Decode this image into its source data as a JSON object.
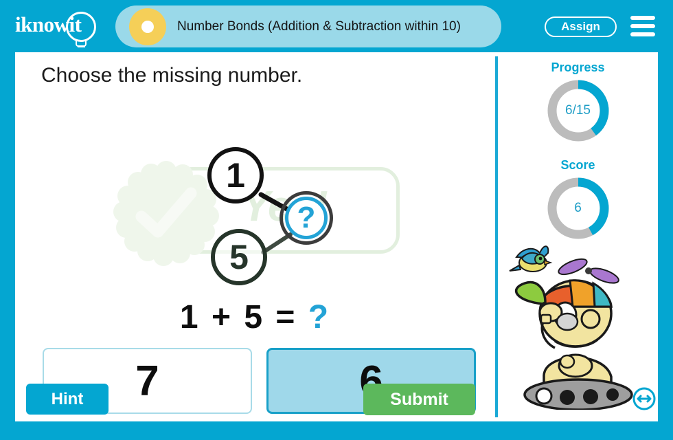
{
  "header": {
    "logo_text": "iknowit",
    "logo_icon": "lightbulb-icon",
    "title": "Number Bonds (Addition & Subtraction within 10)",
    "assign_label": "Assign",
    "menu_icon": "hamburger-menu-icon",
    "bar_color": "#04a6d1",
    "banner_color": "#9ad9e9",
    "dot_color": "#f5cf58"
  },
  "main": {
    "prompt": "Choose the missing number.",
    "number_bond": {
      "part_a": "1",
      "part_b": "5",
      "whole": "?",
      "whole_color": "#23a3d6"
    },
    "equation": {
      "left": "1",
      "operator": "+",
      "right": "5",
      "equals": "=",
      "result": "?"
    },
    "feedback": {
      "text": "Yes!",
      "icon": "check-seal-icon",
      "color": "#a8cf9c"
    },
    "choices": [
      {
        "label": "7",
        "selected": false
      },
      {
        "label": "6",
        "selected": true
      }
    ],
    "hint_label": "Hint",
    "submit_label": "Submit",
    "hint_color": "#04a6d1",
    "submit_color": "#5cb85c"
  },
  "sidebar": {
    "progress": {
      "label": "Progress",
      "value": "6/15",
      "percent": 40,
      "arc_color": "#04a6d1",
      "track_color": "#bcbcbc"
    },
    "score": {
      "label": "Score",
      "value": "6",
      "percent": 42,
      "arc_color": "#04a6d1",
      "track_color": "#bcbcbc"
    },
    "mascot_icon": "robot-mascot-icon",
    "bird_icon": "bird-icon",
    "resize_icon": "resize-horizontal-icon"
  }
}
